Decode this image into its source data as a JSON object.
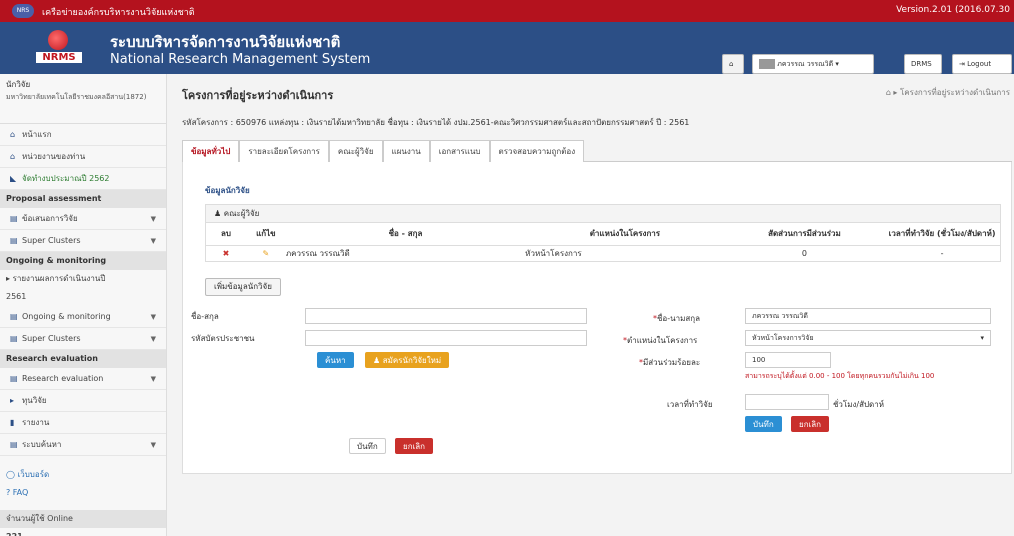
{
  "topbar": {
    "logo_text": "NRS",
    "title": "เครือข่ายองค์กรบริหารงานวิจัยแห่งชาติ",
    "version": "Version.2.01 (2016.07.30"
  },
  "header": {
    "logo_text": "NRMS",
    "title_thai": "ระบบบริหารจัดการงานวิจัยแห่งชาติ",
    "title_eng": "National Research Management System",
    "user_label": "ภควรรณ วรรณวิดี",
    "drms_label": "DRMS",
    "logout_label": "Logout"
  },
  "sidebar": {
    "role": "นักวิจัย",
    "org": "มหาวิทยาลัยเทคโนโลยีราชมงคลอีสาน(1872)",
    "home": "หน้าแรก",
    "agency": "หน่วยงานของท่าน",
    "budget": "จัดทำงบประมาณปี 2562",
    "proposal_head": "Proposal assessment",
    "proposal_item": "ข้อเสนอการวิจัย",
    "super1": "Super Clusters",
    "ongoing_head": "Ongoing & monitoring",
    "report_link": "รายงานผลการดำเนินงานปี",
    "report_year": "2561",
    "ongoing_item": "Ongoing & monitoring",
    "super2": "Super Clusters",
    "research_head": "Research evaluation",
    "research_item": "Research evaluation",
    "fund": "ทุนวิจัย",
    "report": "รายงาน",
    "search": "ระบบค้นหา",
    "webboard": "เว็บบอร์ด",
    "faq": "FAQ",
    "online": "จำนวนผู้ใช้ Online",
    "online_count": "221"
  },
  "main": {
    "title": "โครงการที่อยู่ระหว่างดำเนินการ",
    "breadcrumb": "โครงการที่อยู่ระหว่างดำเนินการ",
    "info": "รหัสโครงการ : 650976  แหล่งทุน : เงินรายได้มหาวิทยาลัย  ชื่อทุน : เงินรายได้ งปม.2561-คณะวิศวกรรมศาสตร์และสถาปัตยกรรมศาสตร์  ปี : 2561",
    "tabs": [
      "ข้อมูลทั่วไป",
      "รายละเอียดโครงการ",
      "คณะผู้วิจัย",
      "แผนงาน",
      "เอกสารแนบ",
      "ตรวจสอบความถูกต้อง"
    ],
    "section": "ข้อมูลนักวิจัย",
    "table_caption": "คณะผู้วิจัย",
    "cols": [
      "ลบ",
      "แก้ไข",
      "ชื่อ - สกุล",
      "ตำแหน่งในโครงการ",
      "สัดส่วนการมีส่วนร่วม",
      "เวลาที่ทำวิจัย (ชั่วโมง/สัปดาห์)"
    ],
    "row": {
      "name": "ภควรรณ วรรณวิดี",
      "position": "หัวหน้าโครงการ",
      "ratio": "0",
      "time": "-"
    },
    "add_button": "เพิ่มข้อมูลนักวิจัย",
    "form": {
      "name_label": "ชื่อ-สกุล",
      "idcard_label": "รหัสบัตรประชาชน",
      "search_button": "ค้นหา",
      "apply_button": "สมัครนักวิจัยใหม่",
      "fullname_label": "ชื่อ-นามสกุล",
      "fullname_value": "ภควรรณ วรรณวิดี",
      "position_label": "ตำแหน่งในโครงการ",
      "position_value": "หัวหน้าโครงการวิจัย",
      "percent_label": "มีส่วนร่วมร้อยละ",
      "percent_value": "100",
      "hint": "สามารถระบุได้ตั้งแต่ 0.00 - 100 โดยทุกคนรวมกันไม่เกิน 100",
      "time_label": "เวลาที่ทำวิจัย",
      "time_unit": "ชั่วโมง/สัปดาห์",
      "save": "บันทึก",
      "cancel": "ยกเลิก",
      "save2": "บันทึก",
      "cancel2": "ยกเลิก"
    }
  }
}
